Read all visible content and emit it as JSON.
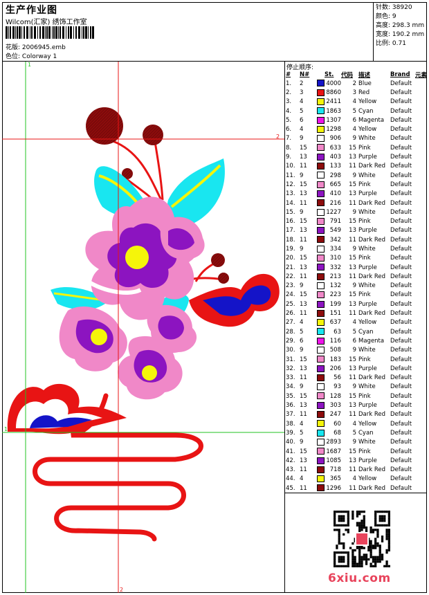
{
  "header": {
    "title": "生产作业图",
    "company": "Wilcom(汇家) 绣饰工作室",
    "design_label": "花版:",
    "design_value": "2006945.emb",
    "color_label": "色位:",
    "color_value": "Colorway 1"
  },
  "stats": [
    {
      "label": "针数:",
      "value": "38920"
    },
    {
      "label": "颜色:",
      "value": "9"
    },
    {
      "label": "高度:",
      "value": "298.3 mm"
    },
    {
      "label": "宽度:",
      "value": "190.2 mm"
    },
    {
      "label": "比例:",
      "value": "0.71"
    }
  ],
  "sequence": {
    "title": "停止顺序:",
    "headers": {
      "no": "#",
      "n": "N#",
      "st": "St.",
      "code": "代码",
      "desc": "描述",
      "brand": "Brand",
      "elem": "元素"
    },
    "rows": [
      {
        "no": "1.",
        "n": "2",
        "color": "#1414c8",
        "st": "4000",
        "code": "2",
        "desc": "Blue",
        "brand": "Default"
      },
      {
        "no": "2.",
        "n": "3",
        "color": "#e81414",
        "st": "8860",
        "code": "3",
        "desc": "Red",
        "brand": "Default"
      },
      {
        "no": "3.",
        "n": "4",
        "color": "#f5f50a",
        "st": "2411",
        "code": "4",
        "desc": "Yellow",
        "brand": "Default"
      },
      {
        "no": "4.",
        "n": "5",
        "color": "#19e6f0",
        "st": "1863",
        "code": "5",
        "desc": "Cyan",
        "brand": "Default"
      },
      {
        "no": "5.",
        "n": "6",
        "color": "#ee14e8",
        "st": "1307",
        "code": "6",
        "desc": "Magenta",
        "brand": "Default"
      },
      {
        "no": "6.",
        "n": "4",
        "color": "#f5f50a",
        "st": "1298",
        "code": "4",
        "desc": "Yellow",
        "brand": "Default"
      },
      {
        "no": "7.",
        "n": "9",
        "color": "#ffffff",
        "st": "906",
        "code": "9",
        "desc": "White",
        "brand": "Default"
      },
      {
        "no": "8.",
        "n": "15",
        "color": "#f088c8",
        "st": "633",
        "code": "15",
        "desc": "Pink",
        "brand": "Default"
      },
      {
        "no": "9.",
        "n": "13",
        "color": "#8c14c0",
        "st": "403",
        "code": "13",
        "desc": "Purple",
        "brand": "Default"
      },
      {
        "no": "10.",
        "n": "11",
        "color": "#8c0c0c",
        "st": "133",
        "code": "11",
        "desc": "Dark Red",
        "brand": "Default"
      },
      {
        "no": "11.",
        "n": "9",
        "color": "#ffffff",
        "st": "298",
        "code": "9",
        "desc": "White",
        "brand": "Default"
      },
      {
        "no": "12.",
        "n": "15",
        "color": "#f088c8",
        "st": "665",
        "code": "15",
        "desc": "Pink",
        "brand": "Default"
      },
      {
        "no": "13.",
        "n": "13",
        "color": "#8c14c0",
        "st": "410",
        "code": "13",
        "desc": "Purple",
        "brand": "Default"
      },
      {
        "no": "14.",
        "n": "11",
        "color": "#8c0c0c",
        "st": "216",
        "code": "11",
        "desc": "Dark Red",
        "brand": "Default"
      },
      {
        "no": "15.",
        "n": "9",
        "color": "#ffffff",
        "st": "1227",
        "code": "9",
        "desc": "White",
        "brand": "Default"
      },
      {
        "no": "16.",
        "n": "15",
        "color": "#f088c8",
        "st": "791",
        "code": "15",
        "desc": "Pink",
        "brand": "Default"
      },
      {
        "no": "17.",
        "n": "13",
        "color": "#8c14c0",
        "st": "549",
        "code": "13",
        "desc": "Purple",
        "brand": "Default"
      },
      {
        "no": "18.",
        "n": "11",
        "color": "#8c0c0c",
        "st": "342",
        "code": "11",
        "desc": "Dark Red",
        "brand": "Default"
      },
      {
        "no": "19.",
        "n": "9",
        "color": "#ffffff",
        "st": "334",
        "code": "9",
        "desc": "White",
        "brand": "Default"
      },
      {
        "no": "20.",
        "n": "15",
        "color": "#f088c8",
        "st": "310",
        "code": "15",
        "desc": "Pink",
        "brand": "Default"
      },
      {
        "no": "21.",
        "n": "13",
        "color": "#8c14c0",
        "st": "332",
        "code": "13",
        "desc": "Purple",
        "brand": "Default"
      },
      {
        "no": "22.",
        "n": "11",
        "color": "#8c0c0c",
        "st": "213",
        "code": "11",
        "desc": "Dark Red",
        "brand": "Default"
      },
      {
        "no": "23.",
        "n": "9",
        "color": "#ffffff",
        "st": "132",
        "code": "9",
        "desc": "White",
        "brand": "Default"
      },
      {
        "no": "24.",
        "n": "15",
        "color": "#f088c8",
        "st": "223",
        "code": "15",
        "desc": "Pink",
        "brand": "Default"
      },
      {
        "no": "25.",
        "n": "13",
        "color": "#8c14c0",
        "st": "199",
        "code": "13",
        "desc": "Purple",
        "brand": "Default"
      },
      {
        "no": "26.",
        "n": "11",
        "color": "#8c0c0c",
        "st": "151",
        "code": "11",
        "desc": "Dark Red",
        "brand": "Default"
      },
      {
        "no": "27.",
        "n": "4",
        "color": "#f5f50a",
        "st": "637",
        "code": "4",
        "desc": "Yellow",
        "brand": "Default"
      },
      {
        "no": "28.",
        "n": "5",
        "color": "#19e6f0",
        "st": "63",
        "code": "5",
        "desc": "Cyan",
        "brand": "Default"
      },
      {
        "no": "29.",
        "n": "6",
        "color": "#ee14e8",
        "st": "116",
        "code": "6",
        "desc": "Magenta",
        "brand": "Default"
      },
      {
        "no": "30.",
        "n": "9",
        "color": "#ffffff",
        "st": "508",
        "code": "9",
        "desc": "White",
        "brand": "Default"
      },
      {
        "no": "31.",
        "n": "15",
        "color": "#f088c8",
        "st": "183",
        "code": "15",
        "desc": "Pink",
        "brand": "Default"
      },
      {
        "no": "32.",
        "n": "13",
        "color": "#8c14c0",
        "st": "206",
        "code": "13",
        "desc": "Purple",
        "brand": "Default"
      },
      {
        "no": "33.",
        "n": "11",
        "color": "#8c0c0c",
        "st": "56",
        "code": "11",
        "desc": "Dark Red",
        "brand": "Default"
      },
      {
        "no": "34.",
        "n": "9",
        "color": "#ffffff",
        "st": "93",
        "code": "9",
        "desc": "White",
        "brand": "Default"
      },
      {
        "no": "35.",
        "n": "15",
        "color": "#f088c8",
        "st": "128",
        "code": "15",
        "desc": "Pink",
        "brand": "Default"
      },
      {
        "no": "36.",
        "n": "13",
        "color": "#8c14c0",
        "st": "303",
        "code": "13",
        "desc": "Purple",
        "brand": "Default"
      },
      {
        "no": "37.",
        "n": "11",
        "color": "#8c0c0c",
        "st": "247",
        "code": "11",
        "desc": "Dark Red",
        "brand": "Default"
      },
      {
        "no": "38.",
        "n": "4",
        "color": "#f5f50a",
        "st": "60",
        "code": "4",
        "desc": "Yellow",
        "brand": "Default"
      },
      {
        "no": "39.",
        "n": "5",
        "color": "#19e6f0",
        "st": "68",
        "code": "5",
        "desc": "Cyan",
        "brand": "Default"
      },
      {
        "no": "40.",
        "n": "9",
        "color": "#ffffff",
        "st": "2893",
        "code": "9",
        "desc": "White",
        "brand": "Default"
      },
      {
        "no": "41.",
        "n": "15",
        "color": "#f088c8",
        "st": "1687",
        "code": "15",
        "desc": "Pink",
        "brand": "Default"
      },
      {
        "no": "42.",
        "n": "13",
        "color": "#8c14c0",
        "st": "1085",
        "code": "13",
        "desc": "Purple",
        "brand": "Default"
      },
      {
        "no": "43.",
        "n": "11",
        "color": "#8c0c0c",
        "st": "718",
        "code": "11",
        "desc": "Dark Red",
        "brand": "Default"
      },
      {
        "no": "44.",
        "n": "4",
        "color": "#f5f50a",
        "st": "365",
        "code": "4",
        "desc": "Yellow",
        "brand": "Default"
      },
      {
        "no": "45.",
        "n": "11",
        "color": "#8c0c0c",
        "st": "1296",
        "code": "11",
        "desc": "Dark Red",
        "brand": "Default"
      }
    ]
  },
  "guides": {
    "v1_label": "1",
    "v2_label": "2",
    "h1_label": "1",
    "h2_label": "2"
  },
  "watermark": "6xiu.com",
  "colors": {
    "guide_green": "#22c322",
    "guide_red": "#e81414"
  }
}
